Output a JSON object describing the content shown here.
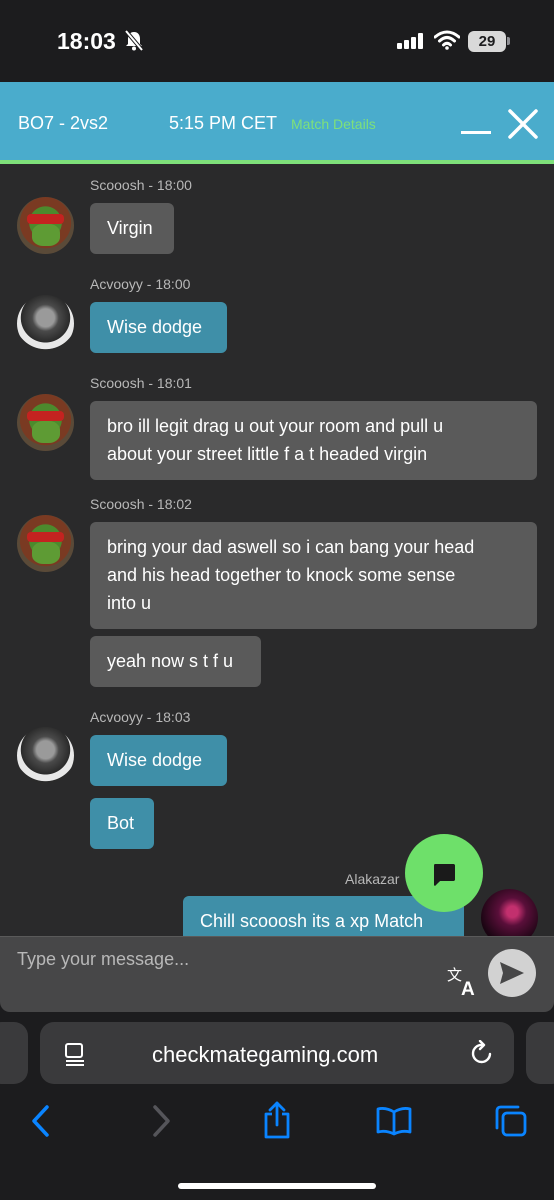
{
  "status_bar": {
    "time": "18:03",
    "battery": "29"
  },
  "header": {
    "title": "BO7 - 2vs2",
    "time": "5:15 PM CET",
    "details_link": "Match Details"
  },
  "messages": [
    {
      "meta": "Scooosh - 18:00",
      "text": "Virgin"
    },
    {
      "meta": "Acvooyy - 18:00",
      "text": "Wise dodge"
    },
    {
      "meta": "Scooosh - 18:01",
      "line1": "bro ill legit drag u out your room and pull u",
      "line2": "about your street little f a t headed virgin"
    },
    {
      "meta": "Scooosh - 18:02",
      "line1": "bring your dad aswell so i can bang your head",
      "line2": "and his head together to knock some sense",
      "line3": "into u",
      "followup": "yeah now s t f u"
    },
    {
      "meta": "Acvooyy - 18:03",
      "text": "Wise dodge",
      "followup": "Bot"
    },
    {
      "meta": "Alakazar",
      "text": "Chill scooosh its a xp Match"
    }
  ],
  "composer": {
    "placeholder": "Type your message..."
  },
  "browser": {
    "url": "checkmategaming.com"
  },
  "colors": {
    "header_bg": "#4aaccc",
    "accent_green": "#7ee07a",
    "bubble_grey": "#5a5a5a",
    "bubble_blue": "#3f8fa8",
    "ios_blue": "#0a84ff"
  },
  "icons": [
    "bell-slash-icon",
    "signal-icon",
    "wifi-icon",
    "chat-bubble-icon",
    "translate-icon",
    "send-icon",
    "reader-icon",
    "reload-icon",
    "back-icon",
    "forward-icon",
    "share-icon",
    "bookmarks-icon",
    "tabs-icon"
  ]
}
